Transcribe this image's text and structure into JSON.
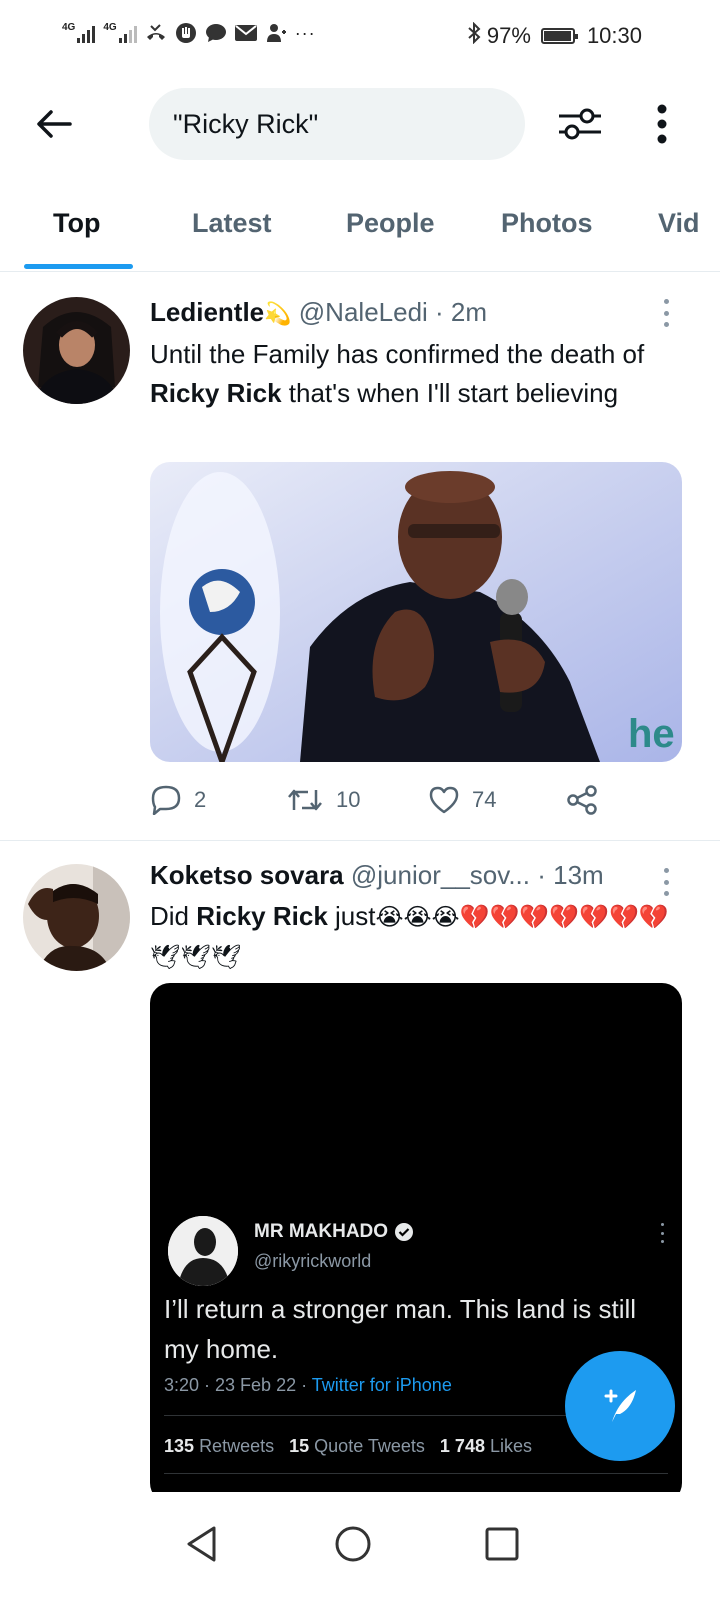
{
  "status_bar": {
    "network_1": "4G",
    "network_2": "4G",
    "battery_pct": "97%",
    "time": "10:30",
    "icons": [
      "signal-icon",
      "signal-icon",
      "missed-call-icon",
      "hand-icon",
      "chat-icon",
      "mail-icon",
      "person-icon",
      "more-notifications-icon",
      "bluetooth-icon",
      "battery-icon"
    ]
  },
  "header": {
    "search_query": "\"Ricky Rick\"",
    "back_icon": "arrow-left-icon",
    "filter_icon": "sliders-icon",
    "more_icon": "vertical-dots-icon"
  },
  "tabs": [
    {
      "label": "Top",
      "active": true
    },
    {
      "label": "Latest",
      "active": false
    },
    {
      "label": "People",
      "active": false
    },
    {
      "label": "Photos",
      "active": false
    },
    {
      "label": "Vid",
      "active": false
    }
  ],
  "tweets": [
    {
      "name": "Ledientle",
      "name_emoji": "💫",
      "handle": "@NaleLedi",
      "time": "· 2m",
      "text_before": "Until the Family has confirmed the death of ",
      "text_bold": "Ricky Rick",
      "text_after": " that's when I'll start believing",
      "replies": "2",
      "retweets": "10",
      "likes": "74"
    },
    {
      "name": "Koketso sovara",
      "handle": "@junior__sov...",
      "time": "· 13m",
      "text_before": "Did ",
      "text_bold": "Ricky Rick",
      "text_after": " just",
      "emojis": "😭😭😭💔💔💔💔💔💔💔🕊🕊🕊",
      "quoted": {
        "name": "MR MAKHADO",
        "handle": "@rikyrickworld",
        "text": "I’ll return a stronger man. This land is still my home.",
        "time": "3:20 · 23 Feb 22 · ",
        "source": "Twitter for iPhone",
        "retweets_count": "135",
        "retweets_label": "Retweets",
        "quotes_count": "15",
        "quotes_label": "Quote Tweets",
        "likes_count": "1 748",
        "likes_label": "Likes"
      }
    }
  ],
  "fab": {
    "icon": "compose-tweet-icon"
  },
  "nav": {
    "icons": [
      "back-triangle-icon",
      "home-circle-icon",
      "recents-square-icon"
    ]
  }
}
